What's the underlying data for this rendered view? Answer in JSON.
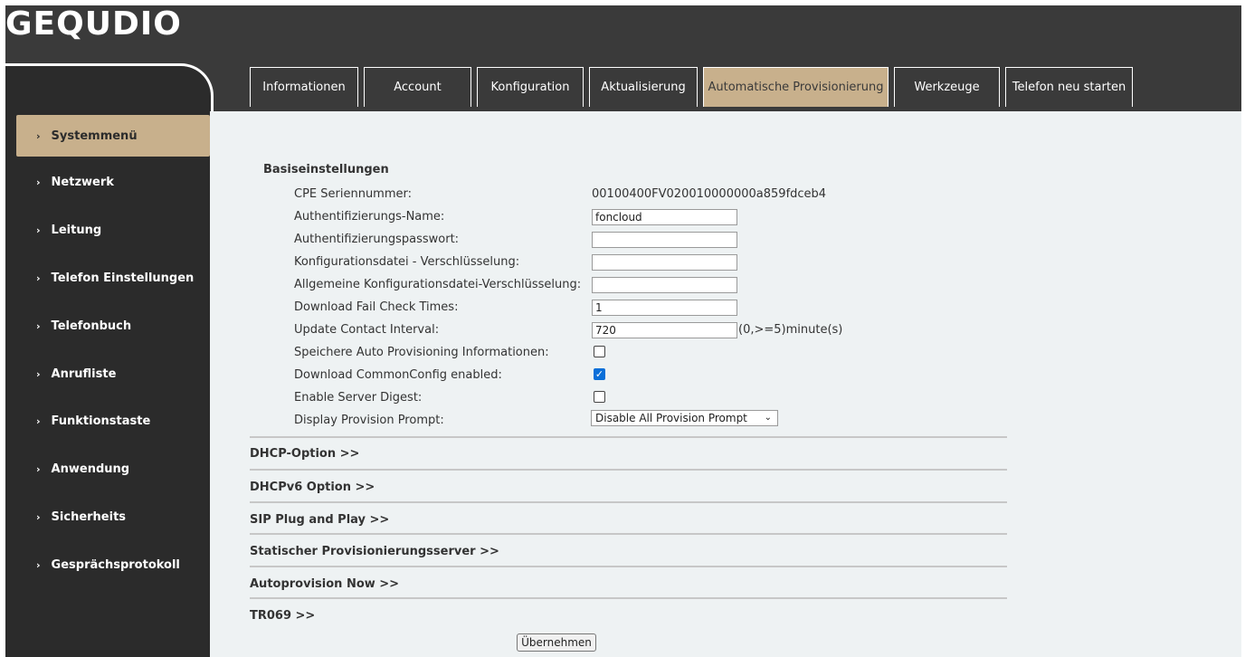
{
  "brand": {
    "logo": "GEQUDIO"
  },
  "tabs": [
    {
      "label": "Informationen",
      "active": false
    },
    {
      "label": "Account",
      "active": false
    },
    {
      "label": "Konfiguration",
      "active": false
    },
    {
      "label": "Aktualisierung",
      "active": false
    },
    {
      "label": "Automatische Provisionierung",
      "active": true
    },
    {
      "label": "Werkzeuge",
      "active": false
    },
    {
      "label": "Telefon neu starten",
      "active": false
    }
  ],
  "sidebar": {
    "items": [
      {
        "label": "Systemmenü",
        "active": true
      },
      {
        "label": "Netzwerk"
      },
      {
        "label": "Leitung"
      },
      {
        "label": "Telefon Einstellungen"
      },
      {
        "label": "Telefonbuch"
      },
      {
        "label": "Anrufliste"
      },
      {
        "label": "Funktionstaste"
      },
      {
        "label": "Anwendung"
      },
      {
        "label": "Sicherheits"
      },
      {
        "label": "Gesprächsprotokoll"
      }
    ]
  },
  "basic": {
    "title": "Basiseinstellungen",
    "cpe_label": "CPE Seriennummer:",
    "cpe_value": "00100400FV020010000000a859fdceb4",
    "auth_name_label": "Authentifizierungs-Name:",
    "auth_name_value": "foncloud",
    "auth_pass_label": "Authentifizierungspasswort:",
    "auth_pass_value": "",
    "cfg_enc_label": "Konfigurationsdatei - Verschlüsselung:",
    "cfg_enc_value": "",
    "common_enc_label": "Allgemeine Konfigurationsdatei-Verschlüsselung:",
    "common_enc_value": "",
    "fail_check_label": "Download Fail Check Times:",
    "fail_check_value": "1",
    "update_interval_label": "Update Contact Interval:",
    "update_interval_value": "720",
    "update_interval_suffix": "(0,>=5)minute(s)",
    "save_info_label": "Speichere Auto Provisioning Informationen:",
    "save_info_checked": false,
    "common_cfg_label": "Download CommonConfig enabled:",
    "common_cfg_checked": true,
    "server_digest_label": "Enable Server Digest:",
    "server_digest_checked": false,
    "prompt_label": "Display Provision Prompt:",
    "prompt_value": "Disable All Provision Prompt"
  },
  "sections": [
    "DHCP-Option >>",
    "DHCPv6 Option >>",
    "SIP Plug and Play >>",
    "Statischer Provisionierungsserver >>",
    "Autoprovision Now >>",
    "TR069 >>"
  ],
  "apply_label": "Übernehmen"
}
